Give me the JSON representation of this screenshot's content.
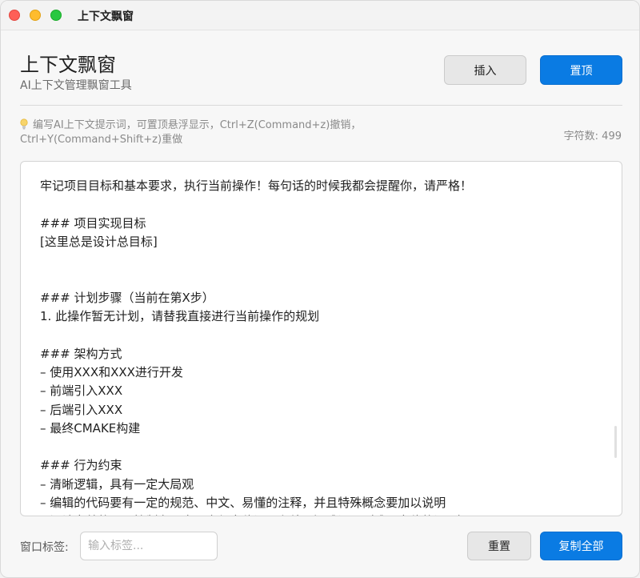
{
  "window": {
    "title": "上下文飘窗"
  },
  "header": {
    "title": "上下文飘窗",
    "subtitle": "AI上下文管理飘窗工具",
    "insert_label": "插入",
    "pin_label": "置顶"
  },
  "hint": {
    "icon": "lightbulb-icon",
    "line1": "编写AI上下文提示词，可置顶悬浮显示，Ctrl+Z(Command+z)撤销，",
    "line2": "Ctrl+Y(Command+Shift+z)重做",
    "char_count_label": "字符数:",
    "char_count_value": "499"
  },
  "editor": {
    "content": "牢记项目目标和基本要求，执行当前操作！每句话的时候我都会提醒你，请严格！\n\n### 项目实现目标\n[这里总是设计总目标]\n\n\n### 计划步骤（当前在第X步）\n1. 此操作暂无计划，请替我直接进行当前操作的规划\n\n### 架构方式\n– 使用XXX和XXX进行开发\n– 前端引入XXX\n– 后端引入XXX\n– 最终CMAKE构建\n\n### 行为约束\n– 清晰逻辑，具有一定大局观\n– 编辑的代码要有一定的规范、中文、易懂的注释，并且特殊概念要加以说明\n– 设计完善的项目控制台日志，方便定位问题和处理疑难问题（难以定位的问题）"
  },
  "footer": {
    "tag_label": "窗口标签:",
    "tag_placeholder": "输入标签...",
    "tag_value": "",
    "reset_label": "重置",
    "copy_label": "复制全部"
  },
  "colors": {
    "accent": "#0a7be3",
    "close": "#fe5f57",
    "minimize": "#febc2e",
    "maximize": "#28c840"
  }
}
